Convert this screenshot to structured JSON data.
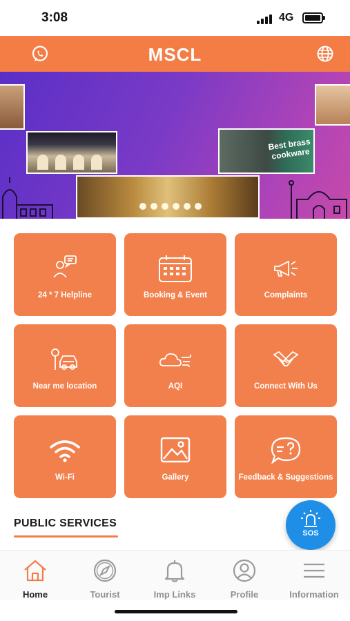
{
  "status_bar": {
    "time": "3:08",
    "network": "4G"
  },
  "header": {
    "title": "MSCL",
    "left_icon": "whatsapp-icon",
    "right_icon": "globe-icon",
    "color": "#f47c45"
  },
  "banner": {
    "tag_text": "Best brass cookware",
    "gradient_start": "#5a2fc7",
    "gradient_end": "#c64aa9"
  },
  "tiles": [
    {
      "label": "24 * 7 Helpline",
      "icon": "helpline-icon"
    },
    {
      "label": "Booking & Event",
      "icon": "calendar-icon"
    },
    {
      "label": "Complaints",
      "icon": "megaphone-icon"
    },
    {
      "label": "Near me location",
      "icon": "location-car-icon"
    },
    {
      "label": "AQI",
      "icon": "cloud-wind-icon"
    },
    {
      "label": "Connect With Us",
      "icon": "handshake-icon"
    },
    {
      "label": "Wi-Fi",
      "icon": "wifi-icon"
    },
    {
      "label": "Gallery",
      "icon": "image-icon"
    },
    {
      "label": "Feedback & Suggestions",
      "icon": "feedback-icon"
    }
  ],
  "tile_color": "#f2804c",
  "section": {
    "title": "PUBLIC SERVICES"
  },
  "sos": {
    "label": "SOS",
    "color": "#1f8ee6"
  },
  "bottom_nav": [
    {
      "label": "Home",
      "icon": "home-icon",
      "active": true
    },
    {
      "label": "Tourist",
      "icon": "compass-icon",
      "active": false
    },
    {
      "label": "Imp Links",
      "icon": "bell-icon",
      "active": false
    },
    {
      "label": "Profile",
      "icon": "profile-icon",
      "active": false
    },
    {
      "label": "Information",
      "icon": "menu-icon",
      "active": false
    }
  ]
}
